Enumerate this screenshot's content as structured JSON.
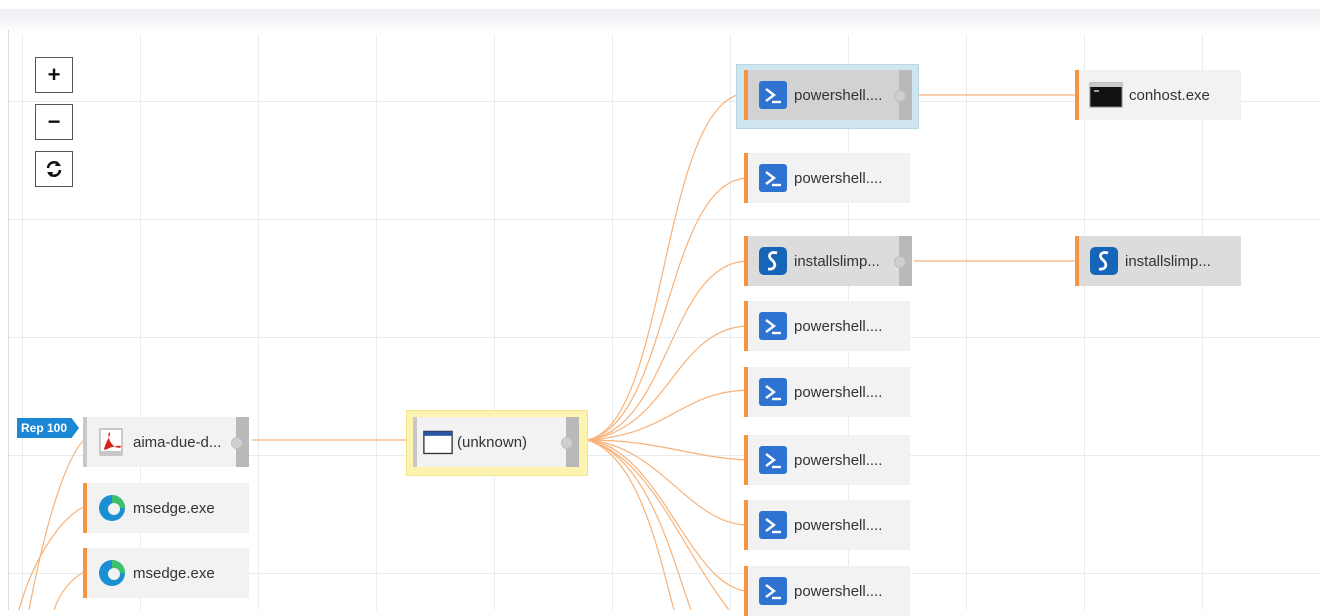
{
  "zoom_controls": {
    "zoom_in": "+",
    "zoom_out": "−",
    "reset": "⟳"
  },
  "badge": {
    "text": "Rep 100"
  },
  "nodes": {
    "pdf": {
      "label": "aima-due-d...",
      "icon": "pdf-icon"
    },
    "msedge1": {
      "label": "msedge.exe",
      "icon": "edge-icon"
    },
    "msedge2": {
      "label": "msedge.exe",
      "icon": "edge-icon"
    },
    "unknown": {
      "label": "(unknown)",
      "icon": "window-icon"
    },
    "ps1": {
      "label": "powershell....",
      "icon": "powershell-icon"
    },
    "ps2": {
      "label": "powershell....",
      "icon": "powershell-icon"
    },
    "install1": {
      "label": "installslimp...",
      "icon": "slimp-icon"
    },
    "ps3": {
      "label": "powershell....",
      "icon": "powershell-icon"
    },
    "ps4": {
      "label": "powershell....",
      "icon": "powershell-icon"
    },
    "ps5": {
      "label": "powershell....",
      "icon": "powershell-icon"
    },
    "ps6": {
      "label": "powershell....",
      "icon": "powershell-icon"
    },
    "ps7": {
      "label": "powershell....",
      "icon": "powershell-icon"
    },
    "conhost": {
      "label": "conhost.exe",
      "icon": "console-icon"
    },
    "install2": {
      "label": "installslimp...",
      "icon": "slimp-icon"
    }
  },
  "colors": {
    "edge": "#f7b27a",
    "node_accent": "#f59441",
    "badge": "#1b88d6",
    "highlight_selected": "#cfe6ee",
    "highlight_focus": "#fdf3b0"
  }
}
